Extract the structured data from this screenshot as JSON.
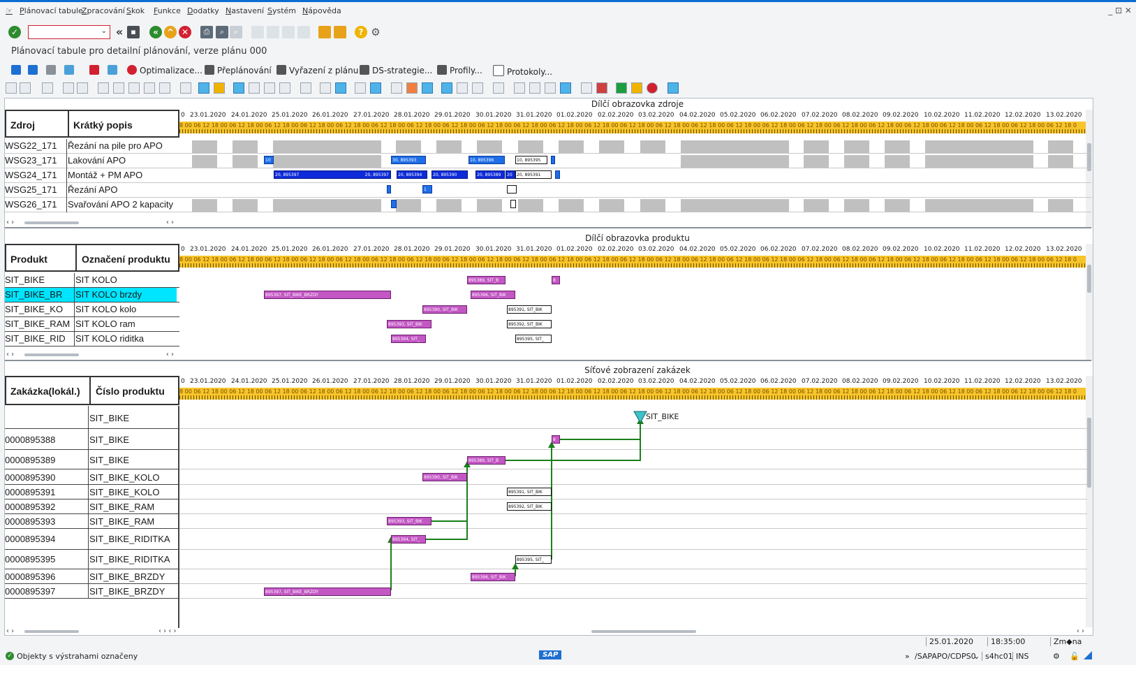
{
  "menu": [
    "Plánovací tabule",
    "Zpracování",
    "Skok",
    "Funkce",
    "Dodatky",
    "Nastavení",
    "Systém",
    "Nápověda"
  ],
  "window_controls": "_ ⊡ ✕",
  "page_title": "Plánovací tabule pro detailní plánování, verze plánu 000",
  "command_field": {
    "value": "",
    "placeholder": ""
  },
  "app_toolbar": {
    "optimize": "Optimalizace...",
    "replan": "Přeplánování",
    "remove": "Vyřazení z plánu",
    "ds_strategy": "DS-strategie...",
    "profiles": "Profily...",
    "logs": "Protokoly..."
  },
  "dates": [
    "23.01.2020",
    "24.01.2020",
    "25.01.2020",
    "26.01.2020",
    "27.01.2020",
    "28.01.2020",
    "29.01.2020",
    "30.01.2020",
    "31.01.2020",
    "01.02.2020",
    "02.02.2020",
    "03.02.2020",
    "04.02.2020",
    "05.02.2020",
    "06.02.2020",
    "07.02.2020",
    "08.02.2020",
    "09.02.2020",
    "10.02.2020",
    "11.02.2020",
    "12.02.2020",
    "13.02.2020"
  ],
  "hours_text": "8 00 06 12 18 00 06 12 18 00 06 12 18 00 06 12 18 00 06 12 18 00 06 12 18 00 06 12 18 00 06 12 18 00 06 12 18 00 06 12 18 00 06 12 18 00 06 12 18 00 06 12 18 00 06 12 18 00 06 12 18 00 06 12 18 00 06 12 18 00 06 12 18 00 06 12 18 00 06 12 18 00 06 12 18 00 06 12 18 00 06 12 18 00 06 12 18 00 06 12 18 0",
  "resources": {
    "title": "Dílčí obrazovka zdroje",
    "col1": "Zdroj",
    "col2": "Krátký popis",
    "rows": [
      {
        "id": "WSG22_171",
        "desc": "Řezání na pile pro APO"
      },
      {
        "id": "WSG23_171",
        "desc": "Lakování APO"
      },
      {
        "id": "WSG24_171",
        "desc": "Montáž + PM APO"
      },
      {
        "id": "WSG25_171",
        "desc": "Řezání APO"
      },
      {
        "id": "WSG26_171",
        "desc": "Svařování APO 2 kapacity"
      }
    ],
    "bar_labels": {
      "r1a": "10",
      "r1b": "30, 895393",
      "r1c": "10, 895396",
      "r1d": "10, 895395",
      "r2a": "20, 895397",
      "r2a2": "20, 895397",
      "r2b": "20, 895394",
      "r2c": "20, 895390",
      "r2d": "20, 895389",
      "r2e": "20",
      "r2f": "20, 895391",
      "r3b": "1"
    }
  },
  "products": {
    "title": "Dílčí obrazovka produktu",
    "col1": "Produkt",
    "col2": "Označení produktu",
    "rows": [
      {
        "id": "SIT_BIKE",
        "desc": "SIT KOLO"
      },
      {
        "id": "SIT_BIKE_BR",
        "desc": "SIT KOLO brzdy"
      },
      {
        "id": "SIT_BIKE_KO",
        "desc": "SIT KOLO kolo"
      },
      {
        "id": "SIT_BIKE_RAM",
        "desc": "SIT KOLO ram"
      },
      {
        "id": "SIT_BIKE_RID",
        "desc": "SIT KOLO riditka"
      }
    ],
    "bar_labels": {
      "p0a": "895389, SIT_B",
      "p0b": "8",
      "p1a": "895397, SIT_BIKE_BRZDY",
      "p1b": "895396, SIT_BIK",
      "p2a": "895390, SIT_BIK",
      "p2b": "895391, SIT_BIK",
      "p3a": "895393, SIT_BIK",
      "p3b": "895392, SIT_BIK",
      "p4a": "895394, SIT_",
      "p4b": "895395, SIT_"
    }
  },
  "orders": {
    "title": "Síťové zobrazení zakázek",
    "col1": "Zakázka(lokál.)",
    "col2": "Číslo produktu",
    "milestone": "SIT_BIKE",
    "rows": [
      {
        "id": "",
        "prod": "SIT_BIKE"
      },
      {
        "id": "0000895388",
        "prod": "SIT_BIKE"
      },
      {
        "id": "0000895389",
        "prod": "SIT_BIKE"
      },
      {
        "id": "0000895390",
        "prod": "SIT_BIKE_KOLO"
      },
      {
        "id": "0000895391",
        "prod": "SIT_BIKE_KOLO"
      },
      {
        "id": "0000895392",
        "prod": "SIT_BIKE_RAM"
      },
      {
        "id": "0000895393",
        "prod": "SIT_BIKE_RAM"
      },
      {
        "id": "0000895394",
        "prod": "SIT_BIKE_RIDITKA"
      },
      {
        "id": "0000895395",
        "prod": "SIT_BIKE_RIDITKA"
      },
      {
        "id": "0000895396",
        "prod": "SIT_BIKE_BRZDY"
      },
      {
        "id": "0000895397",
        "prod": "SIT_BIKE_BRZDY"
      }
    ],
    "bar_labels": {
      "o1": "8",
      "o2": "895389, SIT_B",
      "o3": "895390, SIT_BIK",
      "o4": "895391, SIT_BIK",
      "o5": "895392, SIT_BIK",
      "o6": "895393, SIT_BIK",
      "o7": "895394, SIT_",
      "o8": "895395, SIT_",
      "o9": "895396, SIT_BIK",
      "o10": "895397, SIT_BIKE_BRZDY"
    }
  },
  "info": {
    "date": "25.01.2020",
    "time": "18:35:00",
    "change": "Zm◆na"
  },
  "status": {
    "message": "Objekty s výstrahami označeny",
    "system": "/SAPAPO/CDPS0",
    "client": "s4hc01",
    "mode": "INS",
    "logo": "SAP"
  },
  "colors": {
    "accent": "#0a6ed1",
    "selected_row": "#00e5ff",
    "time_header": "#f7c52a",
    "network_link": "#1b7f1b"
  }
}
